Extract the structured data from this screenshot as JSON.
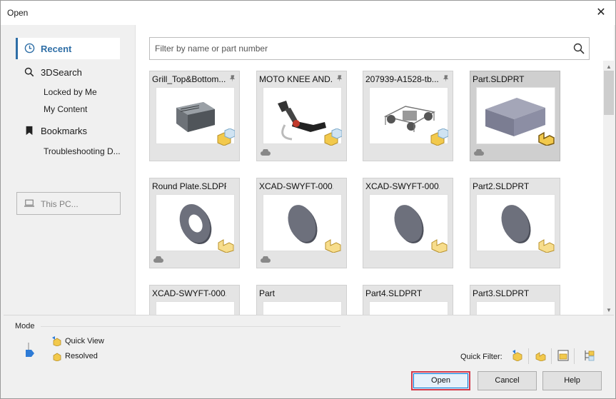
{
  "window": {
    "title": "Open",
    "close_glyph": "✕"
  },
  "sidebar": {
    "recent": {
      "label": "Recent",
      "icon": "clock-icon"
    },
    "search3d": {
      "label": "3DSearch",
      "icon": "search-icon"
    },
    "sub_locked": "Locked by Me",
    "sub_content": "My Content",
    "bookmarks": {
      "label": "Bookmarks",
      "icon": "bookmark-icon"
    },
    "sub_troubleshoot": "Troubleshooting D...",
    "thispc": {
      "label": "This PC...",
      "icon": "laptop-icon"
    }
  },
  "filter": {
    "placeholder": "Filter by name or part number"
  },
  "tiles": [
    {
      "name": "Grill_Top&Bottom...",
      "pinned": true,
      "cloud": false,
      "type": "assembly"
    },
    {
      "name": "MOTO KNEE AND...",
      "pinned": true,
      "cloud": true,
      "type": "assembly"
    },
    {
      "name": "207939-A1528-tb...",
      "pinned": true,
      "cloud": false,
      "type": "assembly"
    },
    {
      "name": "Part.SLDPRT",
      "pinned": false,
      "cloud": true,
      "type": "part",
      "selected": true
    },
    {
      "name": "Round Plate.SLDPRT",
      "pinned": false,
      "cloud": true,
      "type": "part"
    },
    {
      "name": "XCAD-SWYFT-000...",
      "pinned": false,
      "cloud": true,
      "type": "part"
    },
    {
      "name": "XCAD-SWYFT-000...",
      "pinned": false,
      "cloud": false,
      "type": "part"
    },
    {
      "name": "Part2.SLDPRT",
      "pinned": false,
      "cloud": false,
      "type": "part"
    },
    {
      "name": "XCAD-SWYFT-000...",
      "pinned": false,
      "cloud": false,
      "type": "part"
    },
    {
      "name": "Part",
      "pinned": false,
      "cloud": false,
      "type": "part"
    },
    {
      "name": "Part4.SLDPRT",
      "pinned": false,
      "cloud": false,
      "type": "part"
    },
    {
      "name": "Part3.SLDPRT",
      "pinned": false,
      "cloud": false,
      "type": "part"
    }
  ],
  "mode": {
    "label": "Mode",
    "quick_view": "Quick View",
    "resolved": "Resolved"
  },
  "quick_filter": {
    "label": "Quick Filter:"
  },
  "buttons": {
    "open": "Open",
    "cancel": "Cancel",
    "help": "Help"
  },
  "colors": {
    "accent": "#2e6ea6",
    "highlight": "#d33a4a",
    "part_yellow": "#f2c94c"
  }
}
